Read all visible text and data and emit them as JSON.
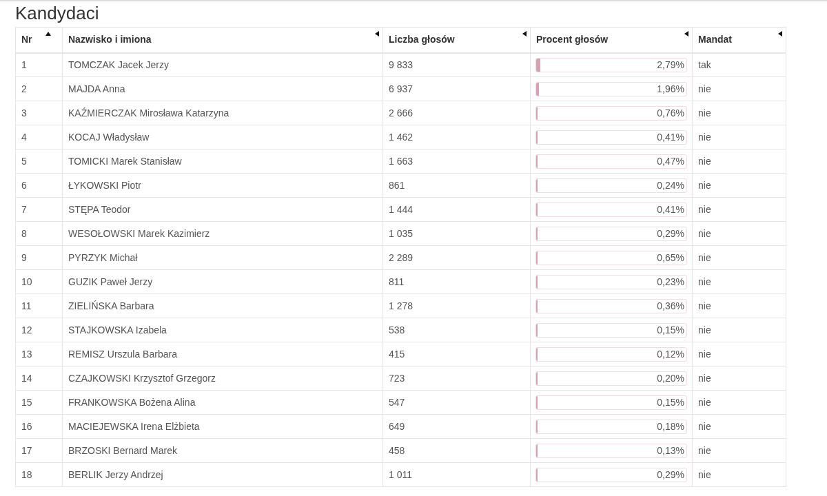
{
  "title": "Kandydaci",
  "table": {
    "columns": [
      {
        "label": "Nr",
        "sorted": true
      },
      {
        "label": "Nazwisko i imiona",
        "sorted": false
      },
      {
        "label": "Liczba głosów",
        "sorted": false
      },
      {
        "label": "Procent głosów",
        "sorted": false
      },
      {
        "label": "Mandat",
        "sorted": false
      }
    ],
    "rows": [
      {
        "nr": "1",
        "name": "TOMCZAK Jacek Jerzy",
        "votes": "9 833",
        "percent": "2,79%",
        "level": 0.0279,
        "mandate": "tak"
      },
      {
        "nr": "2",
        "name": "MAJDA Anna",
        "votes": "6 937",
        "percent": "1,96%",
        "level": 0.0196,
        "mandate": "nie"
      },
      {
        "nr": "3",
        "name": "KAŹMIERCZAK Mirosława Katarzyna",
        "votes": "2 666",
        "percent": "0,76%",
        "level": 0.0076,
        "mandate": "nie"
      },
      {
        "nr": "4",
        "name": "KOCAJ Władysław",
        "votes": "1 462",
        "percent": "0,41%",
        "level": 0.0041,
        "mandate": "nie"
      },
      {
        "nr": "5",
        "name": "TOMICKI Marek Stanisław",
        "votes": "1 663",
        "percent": "0,47%",
        "level": 0.0047,
        "mandate": "nie"
      },
      {
        "nr": "6",
        "name": "ŁYKOWSKI Piotr",
        "votes": "861",
        "percent": "0,24%",
        "level": 0.0024,
        "mandate": "nie"
      },
      {
        "nr": "7",
        "name": "STĘPA Teodor",
        "votes": "1 444",
        "percent": "0,41%",
        "level": 0.0041,
        "mandate": "nie"
      },
      {
        "nr": "8",
        "name": "WESOŁOWSKI Marek Kazimierz",
        "votes": "1 035",
        "percent": "0,29%",
        "level": 0.0029,
        "mandate": "nie"
      },
      {
        "nr": "9",
        "name": "PYRZYK Michał",
        "votes": "2 289",
        "percent": "0,65%",
        "level": 0.0065,
        "mandate": "nie"
      },
      {
        "nr": "10",
        "name": "GUZIK Paweł Jerzy",
        "votes": "811",
        "percent": "0,23%",
        "level": 0.0023,
        "mandate": "nie"
      },
      {
        "nr": "11",
        "name": "ZIELIŃSKA Barbara",
        "votes": "1 278",
        "percent": "0,36%",
        "level": 0.0036,
        "mandate": "nie"
      },
      {
        "nr": "12",
        "name": "STAJKOWSKA Izabela",
        "votes": "538",
        "percent": "0,15%",
        "level": 0.0015,
        "mandate": "nie"
      },
      {
        "nr": "13",
        "name": "REMISZ Urszula Barbara",
        "votes": "415",
        "percent": "0,12%",
        "level": 0.0012,
        "mandate": "nie"
      },
      {
        "nr": "14",
        "name": "CZAJKOWSKI Krzysztof Grzegorz",
        "votes": "723",
        "percent": "0,20%",
        "level": 0.002,
        "mandate": "nie"
      },
      {
        "nr": "15",
        "name": "FRANKOWSKA Bożena Alina",
        "votes": "547",
        "percent": "0,15%",
        "level": 0.0015,
        "mandate": "nie"
      },
      {
        "nr": "16",
        "name": "MACIEJEWSKA Irena Elżbieta",
        "votes": "649",
        "percent": "0,18%",
        "level": 0.0018,
        "mandate": "nie"
      },
      {
        "nr": "17",
        "name": "BRZOSKI Bernard Marek",
        "votes": "458",
        "percent": "0,13%",
        "level": 0.0013,
        "mandate": "nie"
      },
      {
        "nr": "18",
        "name": "BERLIK Jerzy Andrzej",
        "votes": "1 011",
        "percent": "0,29%",
        "level": 0.0029,
        "mandate": "nie"
      }
    ]
  }
}
